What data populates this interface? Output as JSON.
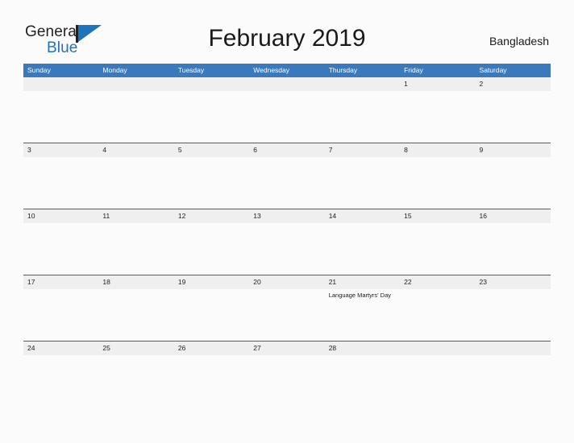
{
  "brand": {
    "name_part1": "General",
    "name_part2": "Blue",
    "flag_icon": "flag-triangle-icon"
  },
  "header": {
    "title": "February 2019",
    "region": "Bangladesh"
  },
  "colors": {
    "header_blue": "#3a79bc",
    "row_border_blue": "#1f6bab",
    "date_band_gray": "#efefef",
    "brand_blue": "#1e73bc",
    "page_background": "#fbfbfb"
  },
  "calendar": {
    "weekdays": [
      "Sunday",
      "Monday",
      "Tuesday",
      "Wednesday",
      "Thursday",
      "Friday",
      "Saturday"
    ],
    "weeks": [
      {
        "days": [
          {
            "num": "",
            "event": ""
          },
          {
            "num": "",
            "event": ""
          },
          {
            "num": "",
            "event": ""
          },
          {
            "num": "",
            "event": ""
          },
          {
            "num": "",
            "event": ""
          },
          {
            "num": "1",
            "event": ""
          },
          {
            "num": "2",
            "event": ""
          }
        ]
      },
      {
        "days": [
          {
            "num": "3",
            "event": ""
          },
          {
            "num": "4",
            "event": ""
          },
          {
            "num": "5",
            "event": ""
          },
          {
            "num": "6",
            "event": ""
          },
          {
            "num": "7",
            "event": ""
          },
          {
            "num": "8",
            "event": ""
          },
          {
            "num": "9",
            "event": ""
          }
        ]
      },
      {
        "days": [
          {
            "num": "10",
            "event": ""
          },
          {
            "num": "11",
            "event": ""
          },
          {
            "num": "12",
            "event": ""
          },
          {
            "num": "13",
            "event": ""
          },
          {
            "num": "14",
            "event": ""
          },
          {
            "num": "15",
            "event": ""
          },
          {
            "num": "16",
            "event": ""
          }
        ]
      },
      {
        "days": [
          {
            "num": "17",
            "event": ""
          },
          {
            "num": "18",
            "event": ""
          },
          {
            "num": "19",
            "event": ""
          },
          {
            "num": "20",
            "event": ""
          },
          {
            "num": "21",
            "event": "Language Martyrs' Day"
          },
          {
            "num": "22",
            "event": ""
          },
          {
            "num": "23",
            "event": ""
          }
        ]
      },
      {
        "days": [
          {
            "num": "24",
            "event": ""
          },
          {
            "num": "25",
            "event": ""
          },
          {
            "num": "26",
            "event": ""
          },
          {
            "num": "27",
            "event": ""
          },
          {
            "num": "28",
            "event": ""
          },
          {
            "num": "",
            "event": ""
          },
          {
            "num": "",
            "event": ""
          }
        ]
      }
    ]
  }
}
